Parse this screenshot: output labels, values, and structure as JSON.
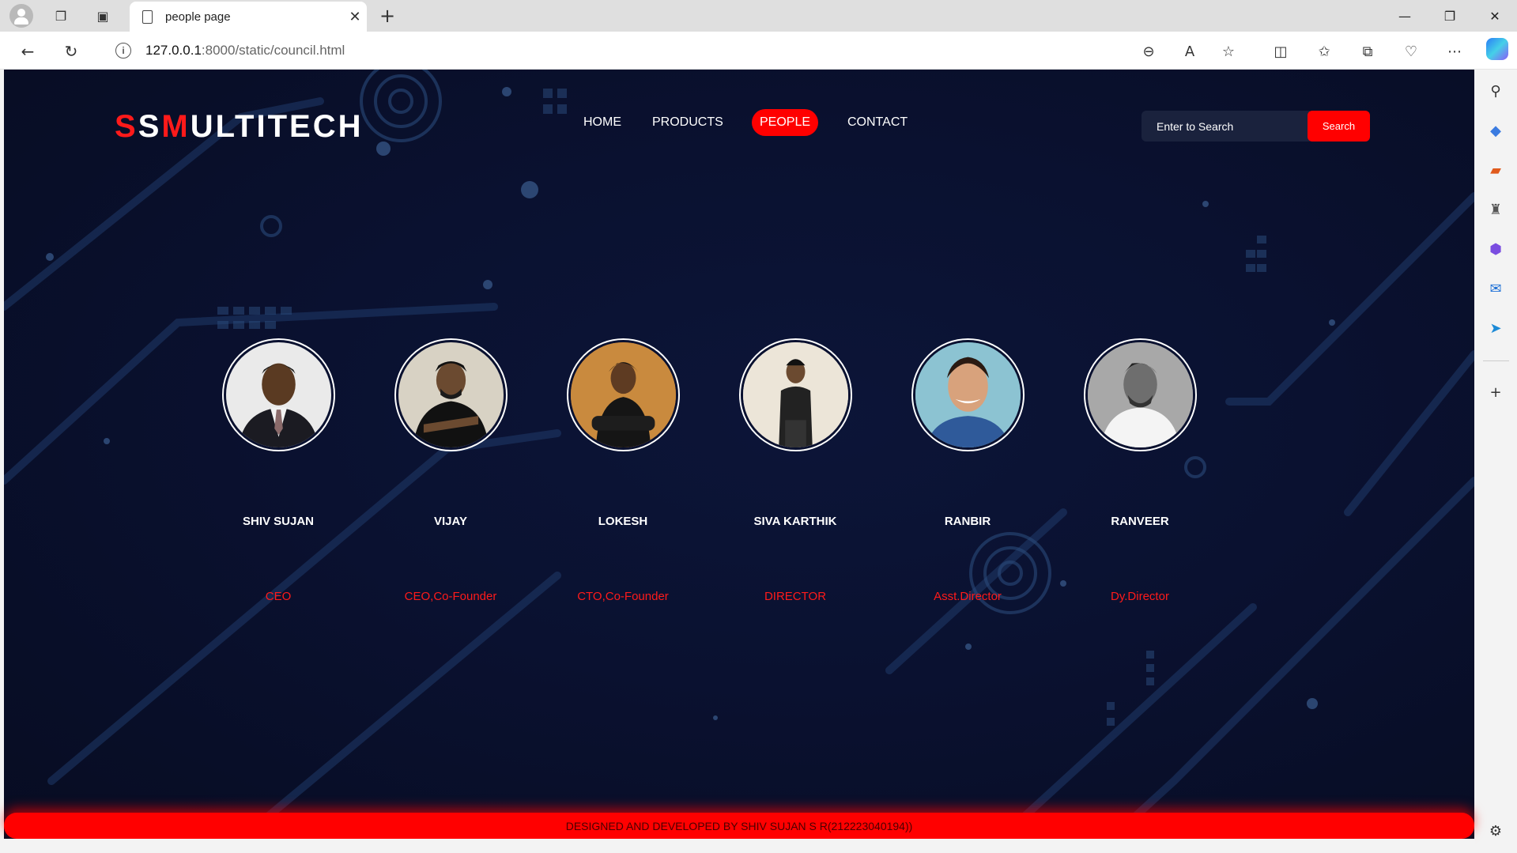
{
  "browser": {
    "tab_title": "people page",
    "url_host": "127.0.0.1",
    "url_path": ":8000/static/council.html"
  },
  "site": {
    "logo_parts": [
      {
        "text": "S",
        "accent": true
      },
      {
        "text": "S",
        "accent": false
      },
      {
        "text": "M",
        "accent": true
      },
      {
        "text": "ULTITECH",
        "accent": false
      }
    ],
    "nav": [
      {
        "label": "HOME",
        "active": false
      },
      {
        "label": "PRODUCTS",
        "active": false
      },
      {
        "label": "PEOPLE",
        "active": true
      },
      {
        "label": "CONTACT",
        "active": false
      }
    ],
    "search": {
      "placeholder": "Enter to Search",
      "button_label": "Search"
    },
    "people": [
      {
        "name": "SHIV SUJAN",
        "role": "CEO"
      },
      {
        "name": "VIJAY",
        "role": "CEO,Co-Founder"
      },
      {
        "name": "LOKESH",
        "role": "CTO,Co-Founder"
      },
      {
        "name": "SIVA KARTHIK",
        "role": "DIRECTOR"
      },
      {
        "name": "RANBIR",
        "role": "Asst.Director"
      },
      {
        "name": "RANVEER",
        "role": "Dy.Director"
      }
    ],
    "footer": "DESIGNED AND DEVELOPED BY SHIV SUJAN S R(212223040194))"
  },
  "colors": {
    "accent": "#ff0000",
    "background": "#0a1130",
    "text": "#ffffff"
  }
}
